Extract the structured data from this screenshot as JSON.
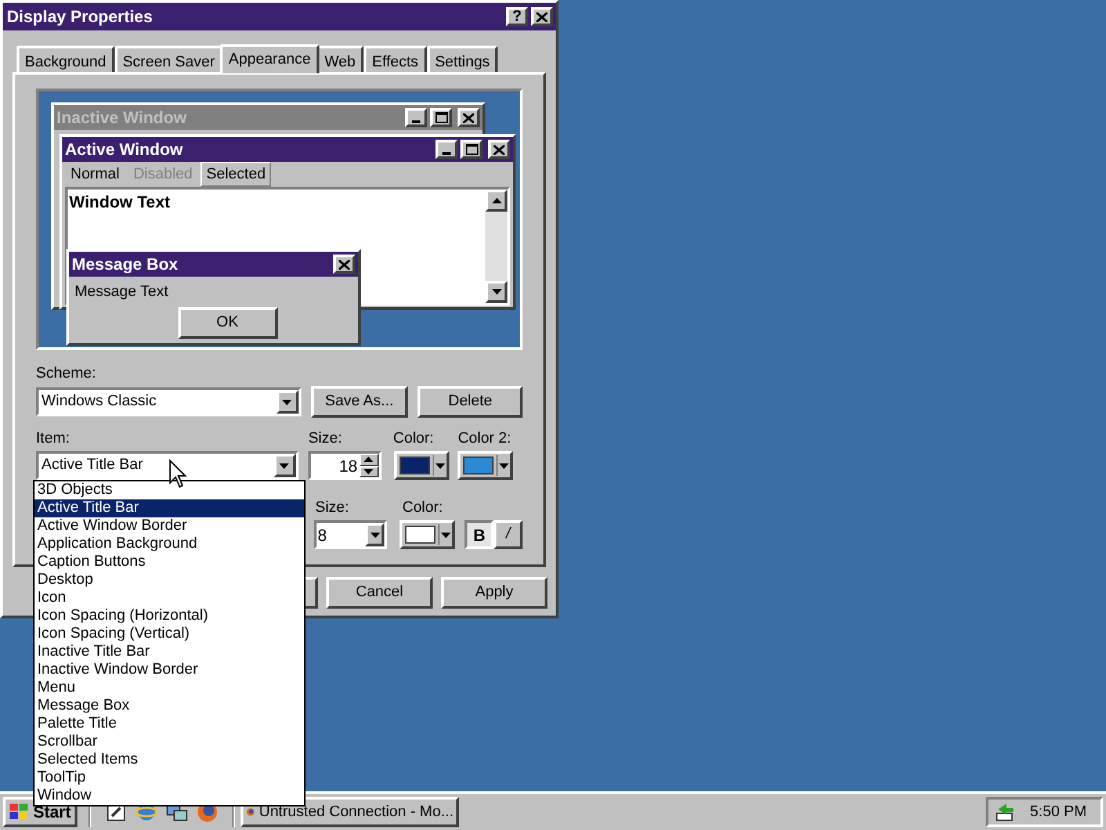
{
  "window": {
    "title": "Display Properties",
    "help": "?"
  },
  "tabs": [
    {
      "label": "Background",
      "selected": false
    },
    {
      "label": "Screen Saver",
      "selected": false
    },
    {
      "label": "Appearance",
      "selected": true
    },
    {
      "label": "Web",
      "selected": false
    },
    {
      "label": "Effects",
      "selected": false
    },
    {
      "label": "Settings",
      "selected": false
    }
  ],
  "preview": {
    "inactive_title": "Inactive Window",
    "active_title": "Active Window",
    "menu": [
      {
        "label": "Normal",
        "disabled": false,
        "selected": false
      },
      {
        "label": "Disabled",
        "disabled": true,
        "selected": false
      },
      {
        "label": "Selected",
        "disabled": false,
        "selected": true
      }
    ],
    "window_text": "Window Text",
    "message_title": "Message Box",
    "message_text": "Message Text",
    "ok": "OK"
  },
  "scheme": {
    "label": "Scheme:",
    "value": "Windows Classic",
    "buttons": [
      "Save As...",
      "Delete"
    ]
  },
  "item": {
    "label": "Item:",
    "value": "Active Title Bar",
    "size_label": "Size:",
    "size": "18",
    "swatches": [
      {
        "label": "Color:",
        "color": "#0a246a"
      },
      {
        "label": "Color 2:",
        "color": "#2a8ad4"
      }
    ]
  },
  "font": {
    "size_label": "Size:",
    "size": "8",
    "color_label": "Color:",
    "color": "#ffffff",
    "bold": {
      "label": "B",
      "pressed": true
    },
    "italic": {
      "label": "/",
      "pressed": false
    }
  },
  "item_list": [
    {
      "label": "3D Objects",
      "selected": false
    },
    {
      "label": "Active Title Bar",
      "selected": true
    },
    {
      "label": "Active Window Border",
      "selected": false
    },
    {
      "label": "Application Background",
      "selected": false
    },
    {
      "label": "Caption Buttons",
      "selected": false
    },
    {
      "label": "Desktop",
      "selected": false
    },
    {
      "label": "Icon",
      "selected": false
    },
    {
      "label": "Icon Spacing (Horizontal)",
      "selected": false
    },
    {
      "label": "Icon Spacing (Vertical)",
      "selected": false
    },
    {
      "label": "Inactive Title Bar",
      "selected": false
    },
    {
      "label": "Inactive Window Border",
      "selected": false
    },
    {
      "label": "Menu",
      "selected": false
    },
    {
      "label": "Message Box",
      "selected": false
    },
    {
      "label": "Palette Title",
      "selected": false
    },
    {
      "label": "Scrollbar",
      "selected": false
    },
    {
      "label": "Selected Items",
      "selected": false
    },
    {
      "label": "ToolTip",
      "selected": false
    },
    {
      "label": "Window",
      "selected": false
    }
  ],
  "buttons": [
    "Cancel",
    "Apply"
  ],
  "taskbar": {
    "start": "Start",
    "task": "Untrusted Connection - Mo...",
    "time": "5:50 PM"
  }
}
